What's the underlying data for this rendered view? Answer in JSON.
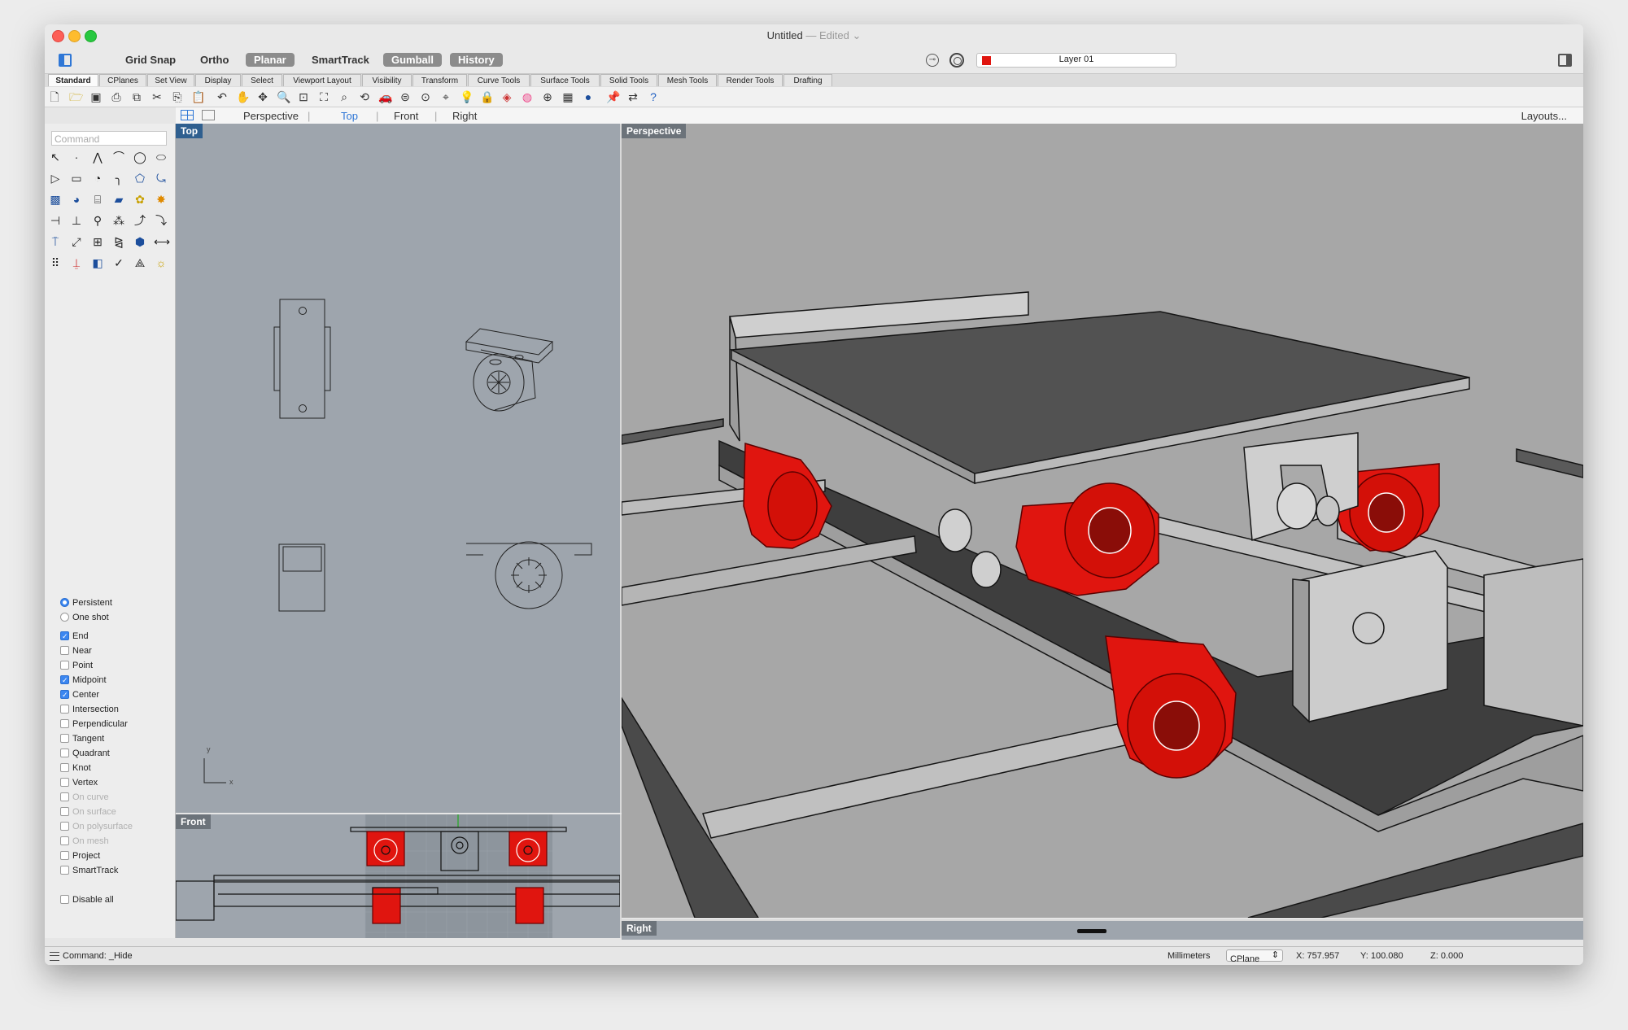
{
  "window": {
    "title": "Untitled",
    "edited": "— Edited ⌄"
  },
  "toolbar": {
    "grid_snap": "Grid Snap",
    "ortho": "Ortho",
    "planar": "Planar",
    "smarttrack": "SmartTrack",
    "gumball": "Gumball",
    "history": "History",
    "layer": "Layer 01",
    "layer_color": "#e0150f"
  },
  "tabs": [
    "Standard",
    "CPlanes",
    "Set View",
    "Display",
    "Select",
    "Viewport Layout",
    "Visibility",
    "Transform",
    "Curve Tools",
    "Surface Tools",
    "Solid Tools",
    "Mesh Tools",
    "Render Tools",
    "Drafting"
  ],
  "viewport_tabs": {
    "perspective": "Perspective",
    "top": "Top",
    "front": "Front",
    "right": "Right",
    "layouts": "Layouts..."
  },
  "sidebar": {
    "command_placeholder": "Command",
    "mode_persistent": "Persistent",
    "mode_oneshot": "One shot",
    "osnaps": [
      {
        "label": "End",
        "checked": true
      },
      {
        "label": "Near",
        "checked": false
      },
      {
        "label": "Point",
        "checked": false
      },
      {
        "label": "Midpoint",
        "checked": true
      },
      {
        "label": "Center",
        "checked": true
      },
      {
        "label": "Intersection",
        "checked": false
      },
      {
        "label": "Perpendicular",
        "checked": false
      },
      {
        "label": "Tangent",
        "checked": false
      },
      {
        "label": "Quadrant",
        "checked": false
      },
      {
        "label": "Knot",
        "checked": false
      },
      {
        "label": "Vertex",
        "checked": false
      },
      {
        "label": "On curve",
        "checked": false
      },
      {
        "label": "On surface",
        "checked": false
      },
      {
        "label": "On polysurface",
        "checked": false
      },
      {
        "label": "On mesh",
        "checked": false
      },
      {
        "label": "Project",
        "checked": false
      },
      {
        "label": "SmartTrack",
        "checked": false
      }
    ],
    "disable_all": "Disable all"
  },
  "viewports": {
    "top": "Top",
    "front": "Front",
    "perspective": "Perspective",
    "right": "Right",
    "axis_x": "x",
    "axis_y": "y"
  },
  "status": {
    "command": "Command: _Hide",
    "units": "Millimeters",
    "cplane": "CPlane",
    "x": "X: 757.957",
    "y": "Y: 100.080",
    "z": "Z: 0.000"
  },
  "colors": {
    "accent_blue": "#2f77d6",
    "viewport_label": "#2f5f8f",
    "model_red": "#e0150f",
    "top_bg": "#9ea5ad"
  }
}
